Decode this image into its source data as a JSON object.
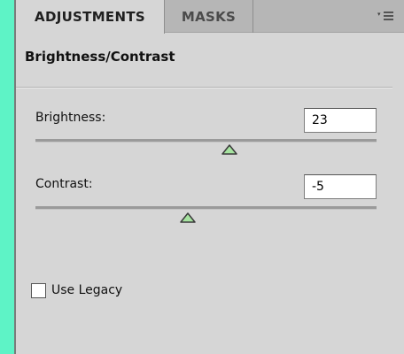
{
  "tabs": [
    {
      "label": "ADJUSTMENTS",
      "active": true
    },
    {
      "label": "MASKS",
      "active": false
    }
  ],
  "panel_menu_icon": "panel-menu-icon",
  "adjustment": {
    "title": "Brightness/Contrast",
    "brightness": {
      "label": "Brightness:",
      "value": "23",
      "min": -150,
      "max": 150
    },
    "contrast": {
      "label": "Contrast:",
      "value": "-5",
      "min": -50,
      "max": 100
    }
  },
  "legacy": {
    "label": "Use Legacy",
    "checked": false
  },
  "colors": {
    "background_accent": "#5ef3c6",
    "panel": "#d6d6d6",
    "slider_thumb": "#a6e3a0"
  }
}
